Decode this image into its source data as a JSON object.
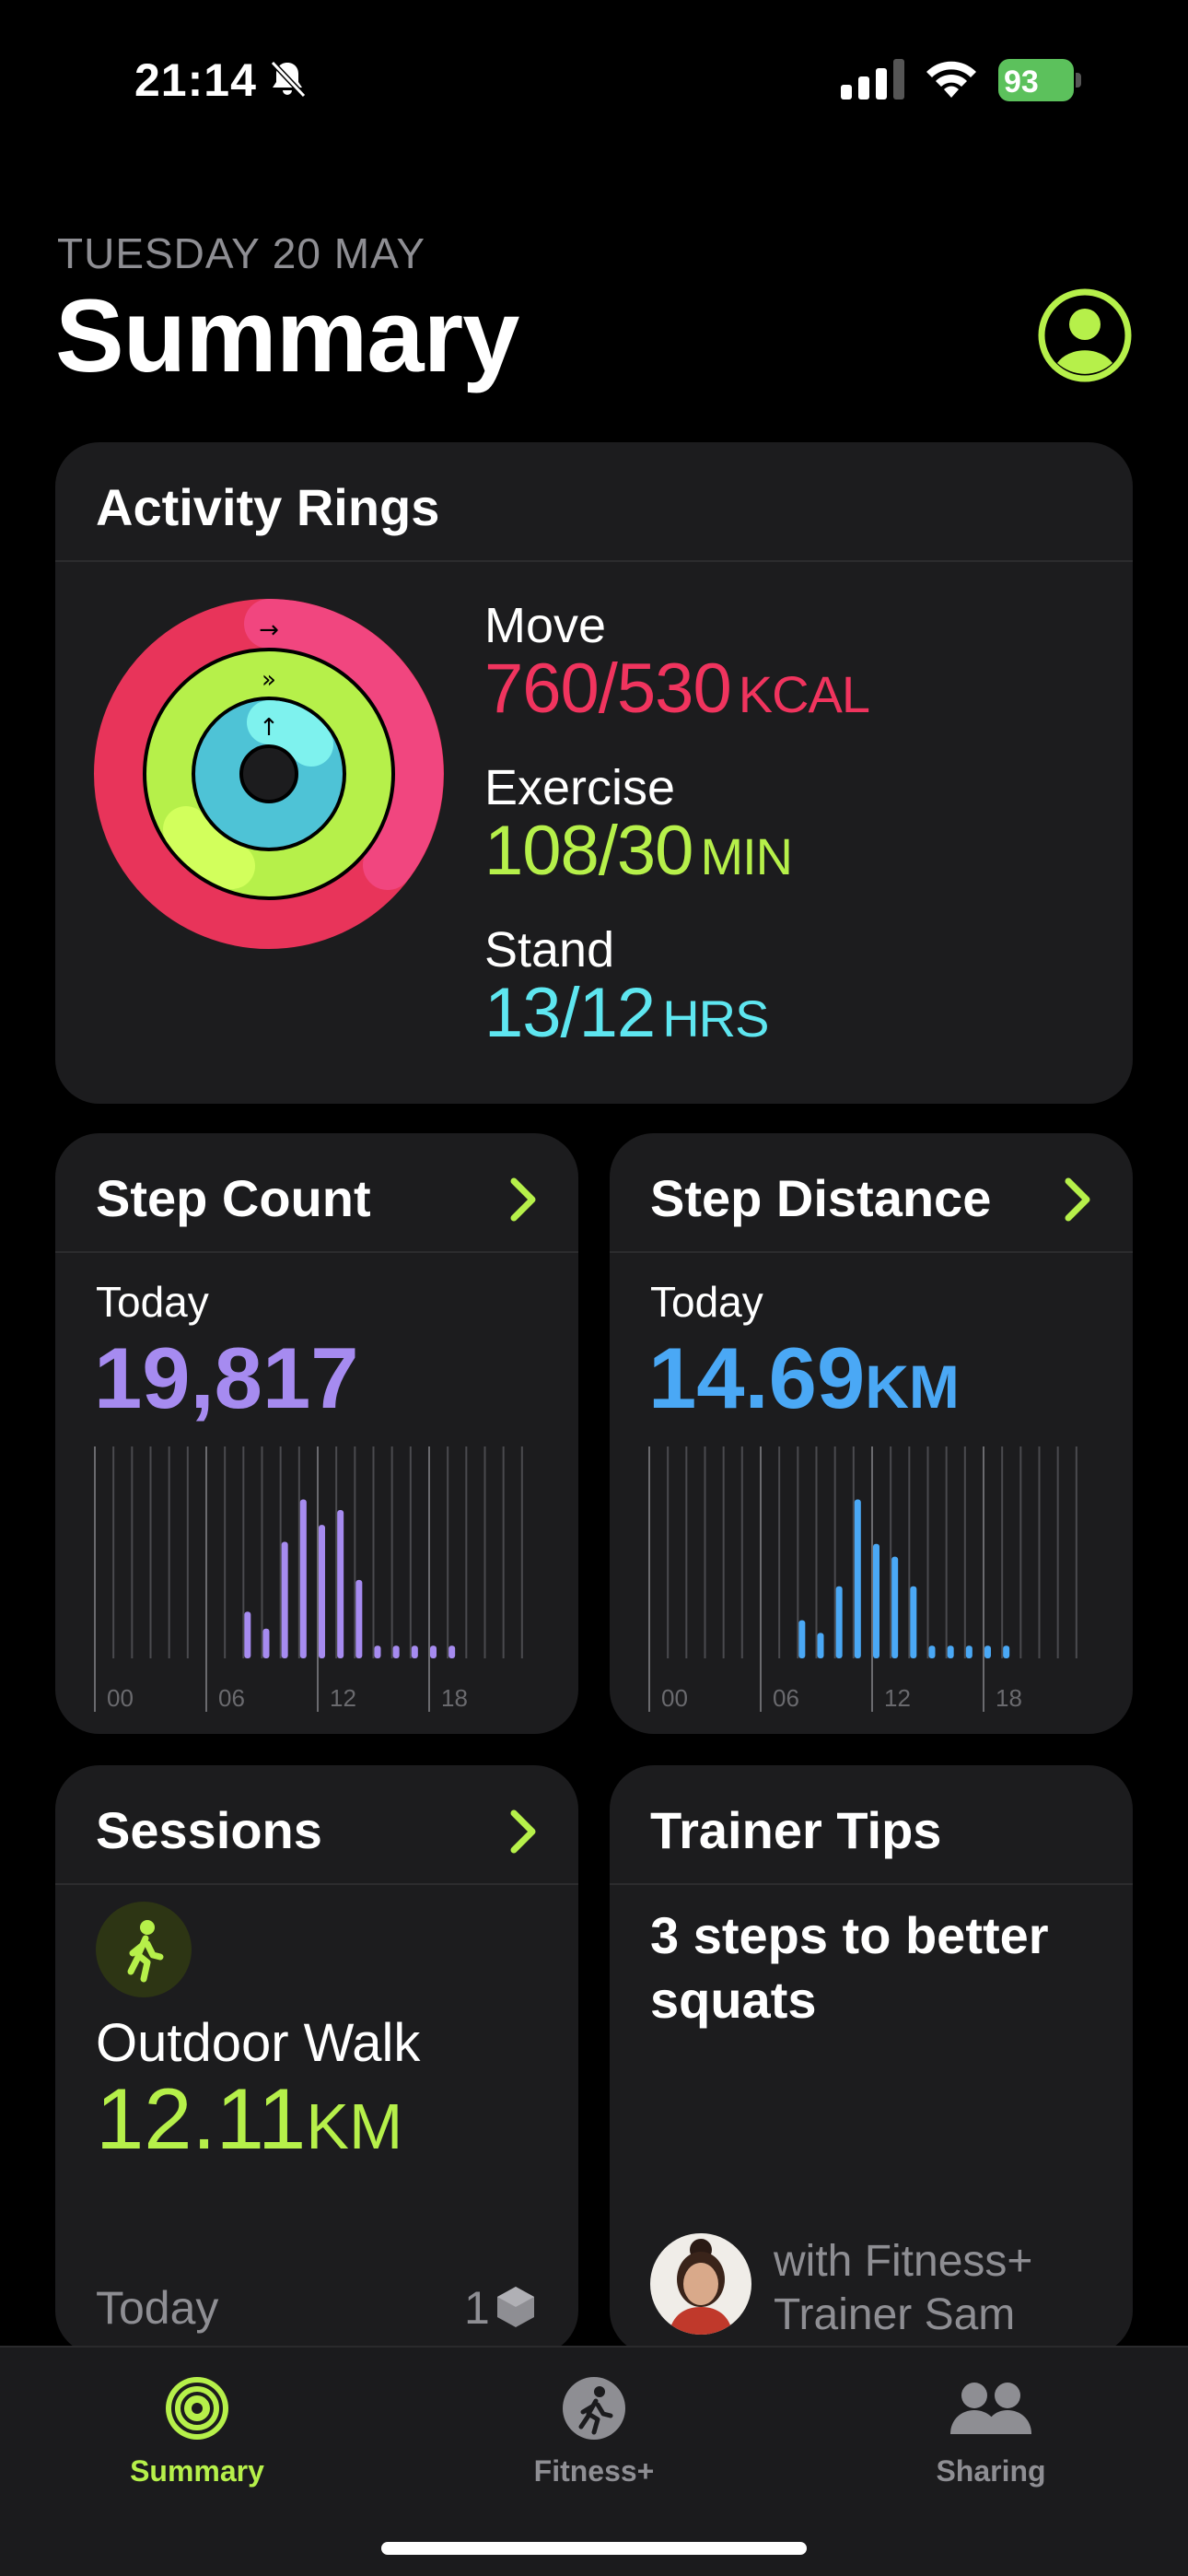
{
  "status_bar": {
    "time": "21:14",
    "battery": "93",
    "icons": [
      "bell-slash-icon",
      "cellular-signal-icon",
      "wifi-icon",
      "battery-charging-icon"
    ]
  },
  "header": {
    "date": "TUESDAY 20 MAY",
    "title": "Summary",
    "profile_icon": "person-circle-icon"
  },
  "colors": {
    "accent": "#b6f04a",
    "move": "#f0345e",
    "exercise": "#b6f04a",
    "stand": "#5ee6f0",
    "steps": "#a68bf0",
    "distance": "#4aa8f5",
    "card": "#1c1c1e",
    "muted": "#8e8e93"
  },
  "activity_rings": {
    "title": "Activity Rings",
    "move": {
      "label": "Move",
      "value": "760/530",
      "unit": "KCAL",
      "progress": 1.434
    },
    "exercise": {
      "label": "Exercise",
      "value": "108/30",
      "unit": "MIN",
      "progress": 3.6
    },
    "stand": {
      "label": "Stand",
      "value": "13/12",
      "unit": "HRS",
      "progress": 1.083
    }
  },
  "step_count": {
    "title": "Step Count",
    "period": "Today",
    "value": "19,817",
    "axis_labels": [
      "00",
      "06",
      "12",
      "18"
    ],
    "chart_data": {
      "type": "bar",
      "x": [
        8,
        9,
        10,
        11,
        12,
        13,
        14,
        15,
        16,
        17,
        18,
        19
      ],
      "values": [
        0.22,
        0.14,
        0.55,
        0.75,
        0.63,
        0.7,
        0.37,
        0.06,
        0.06,
        0.06,
        0.06,
        0.06
      ],
      "xlim": [
        0,
        24
      ]
    }
  },
  "step_distance": {
    "title": "Step Distance",
    "period": "Today",
    "value": "14.69",
    "unit": "KM",
    "axis_labels": [
      "00",
      "06",
      "12",
      "18"
    ],
    "chart_data": {
      "type": "bar",
      "x": [
        8,
        9,
        10,
        11,
        12,
        13,
        14,
        15,
        16,
        17,
        18,
        19
      ],
      "values": [
        0.18,
        0.12,
        0.34,
        0.75,
        0.54,
        0.48,
        0.34,
        0.06,
        0.06,
        0.06,
        0.06,
        0.06
      ],
      "xlim": [
        0,
        24
      ]
    }
  },
  "sessions": {
    "title": "Sessions",
    "workout_icon": "figure-walk-icon",
    "workout_name": "Outdoor Walk",
    "distance": "12.11",
    "unit": "KM",
    "period": "Today",
    "count": "1"
  },
  "trainer_tips": {
    "title": "Trainer Tips",
    "tip": "3 steps to better squats",
    "trainer_line1": "with Fitness+",
    "trainer_line2": "Trainer Sam"
  },
  "tab_bar": {
    "tabs": [
      {
        "label": "Summary",
        "icon": "summary-rings-icon",
        "active": true
      },
      {
        "label": "Fitness+",
        "icon": "fitness-plus-icon",
        "active": false
      },
      {
        "label": "Sharing",
        "icon": "sharing-people-icon",
        "active": false
      }
    ]
  }
}
